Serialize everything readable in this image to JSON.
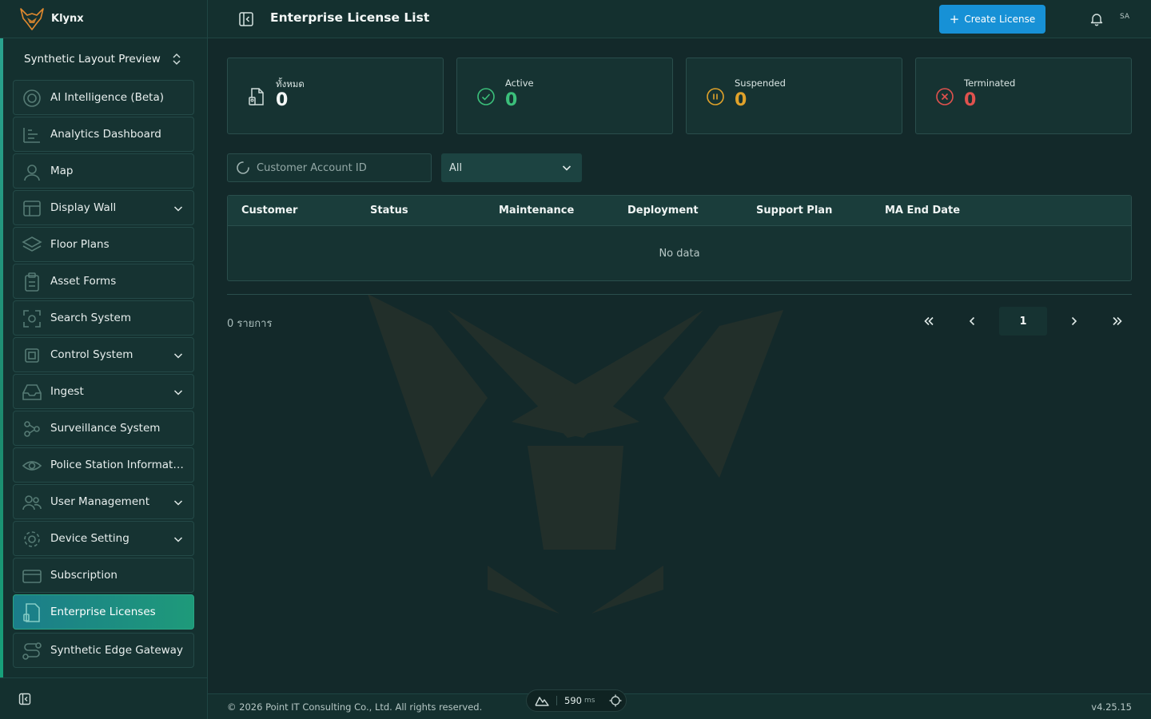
{
  "brand": {
    "name": "Klynx"
  },
  "workspace": {
    "name": "Synthetic Layout Preview"
  },
  "sidebar": {
    "items": [
      {
        "label": "AI Intelligence (Beta)",
        "icon": "ai-icon",
        "expandable": false
      },
      {
        "label": "Analytics Dashboard",
        "icon": "chart-icon",
        "expandable": false
      },
      {
        "label": "Map",
        "icon": "map-pin-icon",
        "expandable": false
      },
      {
        "label": "Display Wall",
        "icon": "display-icon",
        "expandable": true
      },
      {
        "label": "Floor Plans",
        "icon": "layers-icon",
        "expandable": false
      },
      {
        "label": "Asset Forms",
        "icon": "clipboard-icon",
        "expandable": false
      },
      {
        "label": "Search System",
        "icon": "scan-icon",
        "expandable": false
      },
      {
        "label": "Control System",
        "icon": "cpu-icon",
        "expandable": true
      },
      {
        "label": "Ingest",
        "icon": "inbox-icon",
        "expandable": true
      },
      {
        "label": "Surveillance System",
        "icon": "network-icon",
        "expandable": false
      },
      {
        "label": "Police Station Informati...",
        "icon": "eye-icon",
        "expandable": false
      },
      {
        "label": "User Management",
        "icon": "users-icon",
        "expandable": true
      },
      {
        "label": "Device Setting",
        "icon": "gear-icon",
        "expandable": true
      },
      {
        "label": "Subscription",
        "icon": "card-icon",
        "expandable": false
      },
      {
        "label": "Enterprise Licenses",
        "icon": "license-icon",
        "expandable": false,
        "active": true
      },
      {
        "label": "Synthetic Edge Gateway",
        "icon": "route-icon",
        "expandable": false
      }
    ]
  },
  "header": {
    "title": "Enterprise License List",
    "create_label": "Create License",
    "avatar_initials": "SA"
  },
  "stats": [
    {
      "label": "ทั้งหมด",
      "value": "0",
      "color": "#f4f8f7",
      "icon": "document-icon"
    },
    {
      "label": "Active",
      "value": "0",
      "color": "#3bbf7a",
      "icon": "check-circle-icon"
    },
    {
      "label": "Suspended",
      "value": "0",
      "color": "#e0a22a",
      "icon": "pause-circle-icon"
    },
    {
      "label": "Terminated",
      "value": "0",
      "color": "#e0524e",
      "icon": "x-circle-icon"
    }
  ],
  "filters": {
    "search_placeholder": "Customer Account ID",
    "status_value": "All"
  },
  "table": {
    "columns": [
      "Customer",
      "Status",
      "Maintenance",
      "Deployment",
      "Support Plan",
      "MA End Date"
    ],
    "empty_text": "No data"
  },
  "pagination": {
    "count_text": "0 รายการ",
    "current_page": "1"
  },
  "footer": {
    "copyright": "© 2026 Point IT Consulting Co., Ltd. All rights reserved.",
    "version": "v4.25.15",
    "perf_value": "590",
    "perf_unit": "ms"
  },
  "colors": {
    "accent": "#1791d6",
    "active_nav": "#1e9a7a",
    "background": "#13292a"
  }
}
